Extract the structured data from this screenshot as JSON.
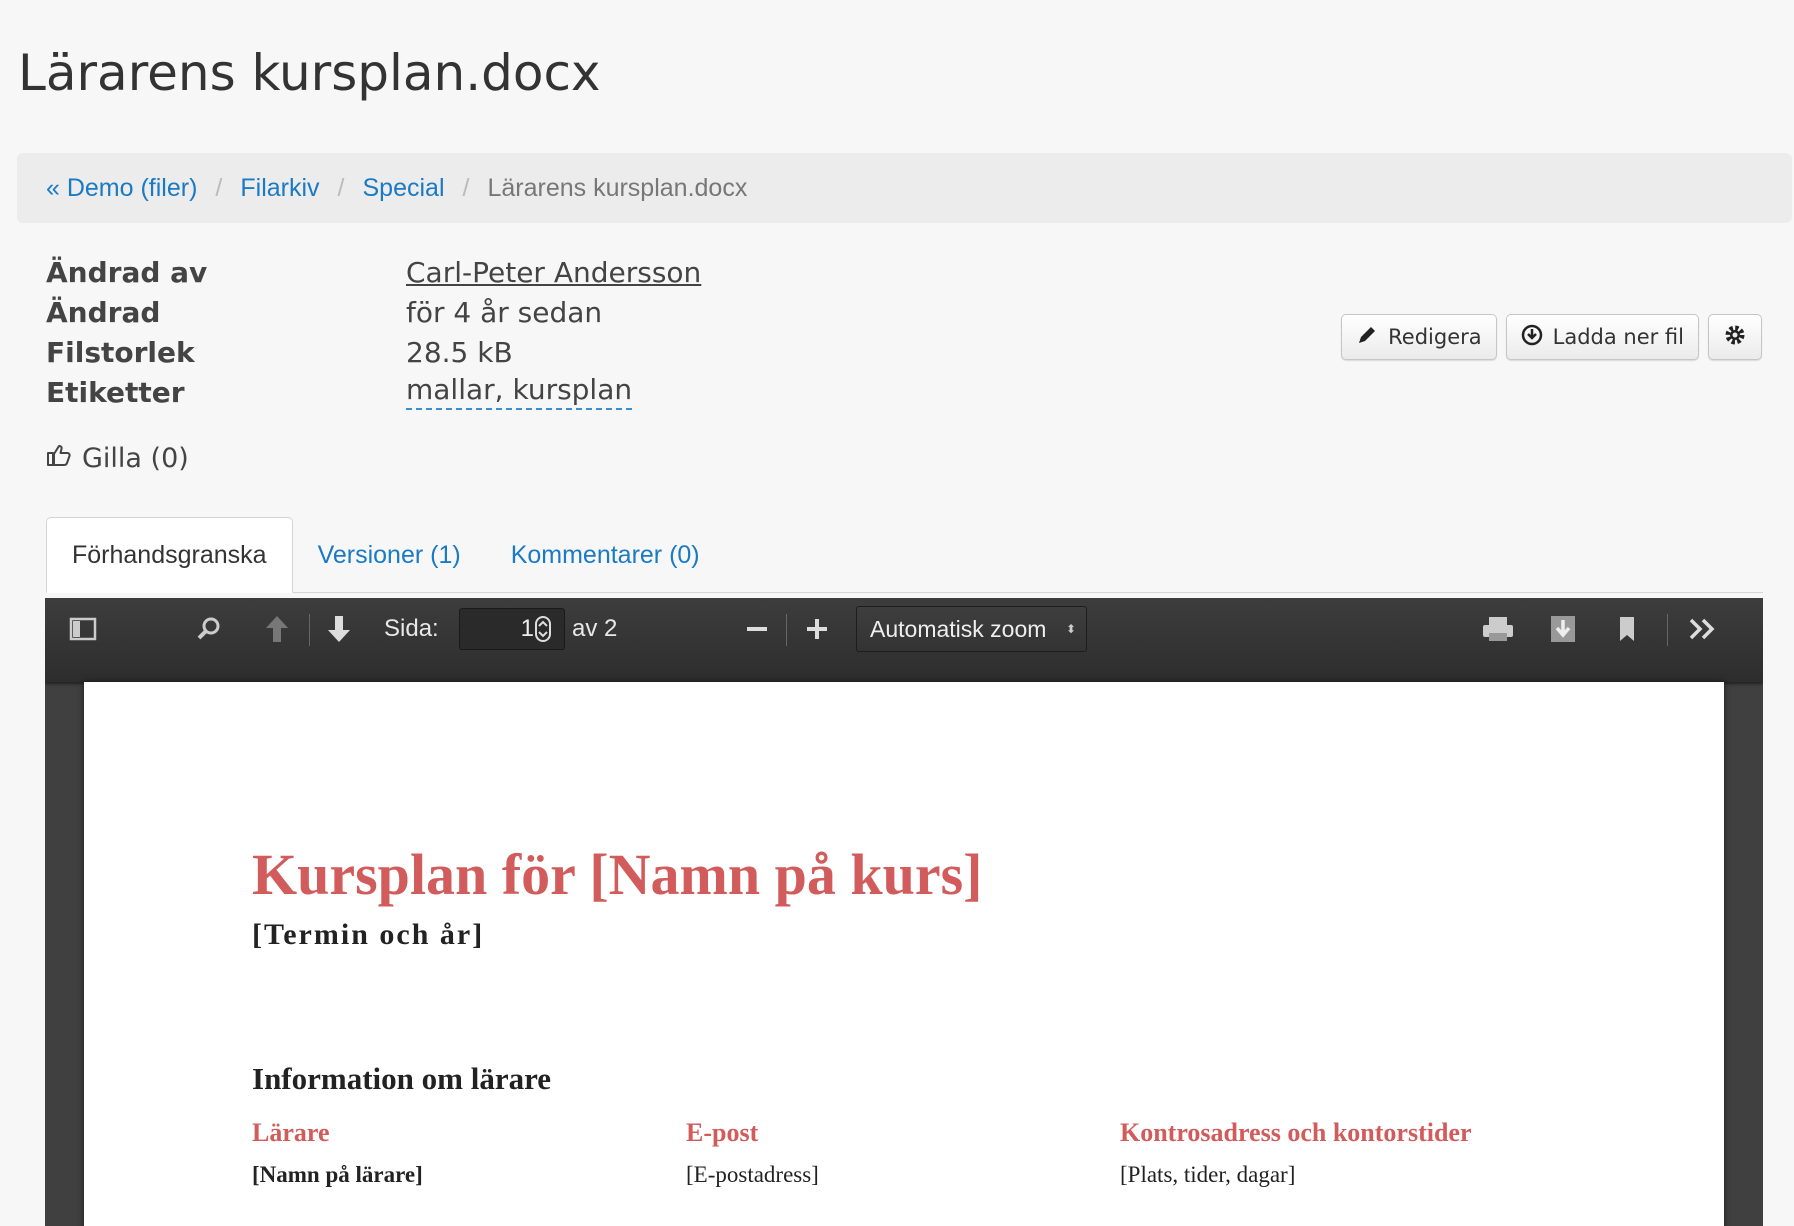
{
  "page": {
    "title": "Lärarens kursplan.docx"
  },
  "breadcrumb": {
    "items": [
      "« Demo (filer)",
      "Filarkiv",
      "Special"
    ],
    "separator": "/",
    "current": "Lärarens kursplan.docx"
  },
  "meta": {
    "changed_by_label": "Ändrad av",
    "changed_by_value": "Carl-Peter Andersson",
    "changed_label": "Ändrad",
    "changed_value": "för 4 år sedan",
    "size_label": "Filstorlek",
    "size_value": "28.5 kB",
    "tags_label": "Etiketter",
    "tags_value": "mallar, kursplan"
  },
  "like": {
    "label": "Gilla (0)"
  },
  "actions": {
    "edit_label": "Redigera",
    "download_label": "Ladda ner fil"
  },
  "tabs": [
    {
      "label": "Förhandsgranska",
      "active": true
    },
    {
      "label": "Versioner (1)",
      "active": false
    },
    {
      "label": "Kommentarer (0)",
      "active": false
    }
  ],
  "viewer": {
    "page_label": "Sida:",
    "page_value": "1",
    "page_total": "av 2",
    "zoom_value": "Automatisk zoom",
    "icons": [
      "sidebar-toggle-icon",
      "search-icon",
      "previous-page-icon",
      "next-page-icon",
      "zoom-out-icon",
      "zoom-in-icon",
      "print-icon",
      "download-icon",
      "bookmark-icon",
      "tools-icon"
    ]
  },
  "document": {
    "title": "Kursplan för [Namn på kurs]",
    "subtitle": "[Termin och år]",
    "section_heading": "Information om lärare",
    "columns": [
      {
        "header": "Lärare",
        "value": "[Namn på lärare]"
      },
      {
        "header": "E-post",
        "value": "[E-postadress]"
      },
      {
        "header": "Kontrosadress och kontorstider",
        "value": "[Plats, tider, dagar]"
      }
    ]
  },
  "colors": {
    "link": "#1a7ac4",
    "doc_accent": "#d25c5c",
    "viewer_bg": "#404040"
  }
}
